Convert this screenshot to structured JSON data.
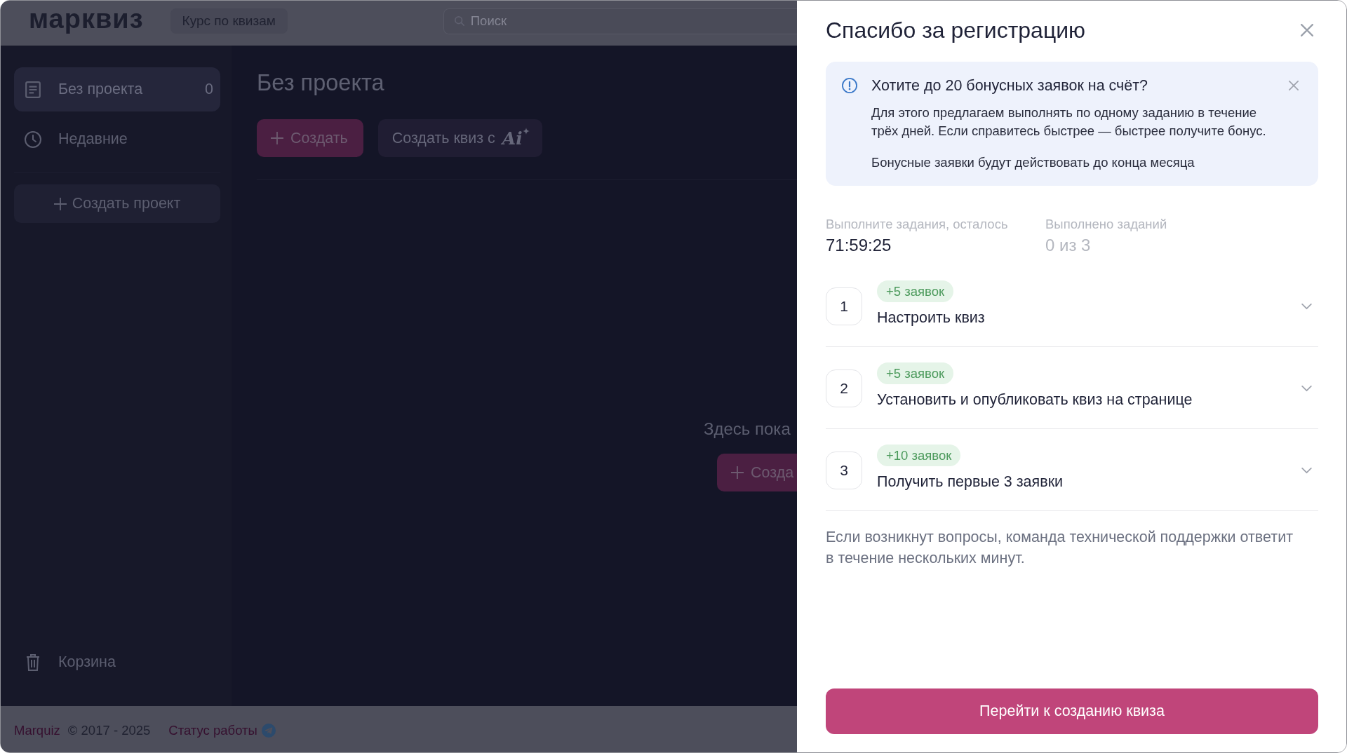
{
  "header": {
    "logo": "марквиз",
    "course_button": "Курс по квизам",
    "search": {
      "placeholder": "Поиск"
    }
  },
  "sidebar": {
    "items": [
      {
        "label": "Без проекта",
        "count": "0",
        "selected": true
      },
      {
        "label": "Недавние",
        "selected": false
      }
    ],
    "create_project_button": "Создать проект",
    "trash": "Корзина"
  },
  "main": {
    "title": "Без проекта",
    "buttons": [
      {
        "kind": "primary",
        "label": "Создать"
      },
      {
        "kind": "ai",
        "label": "Создать квиз с",
        "suffix": "Ai"
      }
    ],
    "empty_state": {
      "text": "Здесь пока",
      "button": "Созда"
    }
  },
  "footer": {
    "brand_link": "Marquiz",
    "copyright": "© 2017 - 2025",
    "status_link": "Статус работы"
  },
  "panel": {
    "title": "Спасибо за регистрацию",
    "notice": {
      "title": "Хотите до 20 бонусных заявок на счёт?",
      "body": "Для этого предлагаем выполнять по одному заданию в течение трёх дней. Если справитесь быстрее — быстрее получите бонус.",
      "note": "Бонусные заявки будут действовать до конца месяца"
    },
    "stats": [
      {
        "kind": "countdown",
        "label": "Выполните задания, осталось",
        "value": "71:59:25"
      },
      {
        "kind": "counter",
        "label": "Выполнено заданий",
        "value": "0 из 3"
      }
    ],
    "tasks": [
      {
        "number": "1",
        "reward": "+5 заявок",
        "title": "Настроить квиз",
        "expanded": false
      },
      {
        "number": "2",
        "reward": "+5 заявок",
        "title": "Установить и опубликовать квиз на странице",
        "expanded": false
      },
      {
        "number": "3",
        "reward": "+10 заявок",
        "title": "Получить первые 3 заявки",
        "expanded": false
      }
    ],
    "help_text": "Если возникнут вопросы, команда технической поддержки ответит в течение нескольких минут.",
    "cta_button": "Перейти к созданию квиза"
  }
}
